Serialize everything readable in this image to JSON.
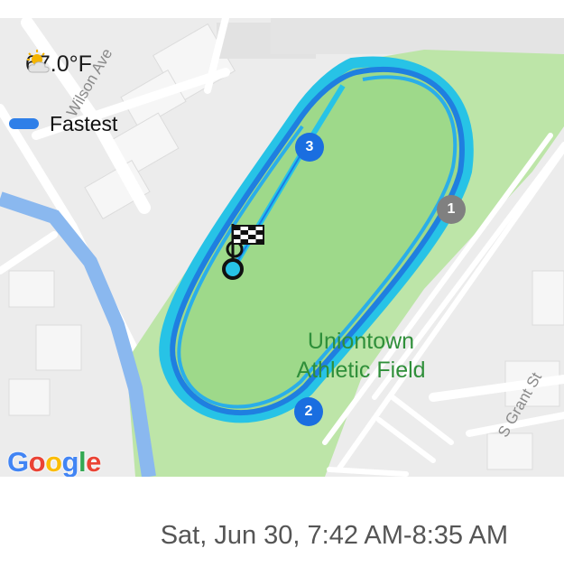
{
  "weather": {
    "icon": "partly-sunny-icon",
    "temperature": "67.0°F"
  },
  "legend": {
    "label": "Fastest",
    "color": "#2f7fe8"
  },
  "map": {
    "park_name_line1": "Uniontown",
    "park_name_line2": "Athletic Field",
    "streets": {
      "wilson": "Wilson Ave",
      "grant": "S Grant St"
    },
    "google_logo": "Google",
    "lap_markers": [
      {
        "label": "1",
        "color": "#808080"
      },
      {
        "label": "2",
        "color": "#1a6ee0"
      },
      {
        "label": "3",
        "color": "#1a6ee0"
      }
    ],
    "start_icon": "checkered-flag-icon"
  },
  "footer": {
    "date_range": "Sat, Jun 30, 7:42 AM-8:35 AM"
  }
}
